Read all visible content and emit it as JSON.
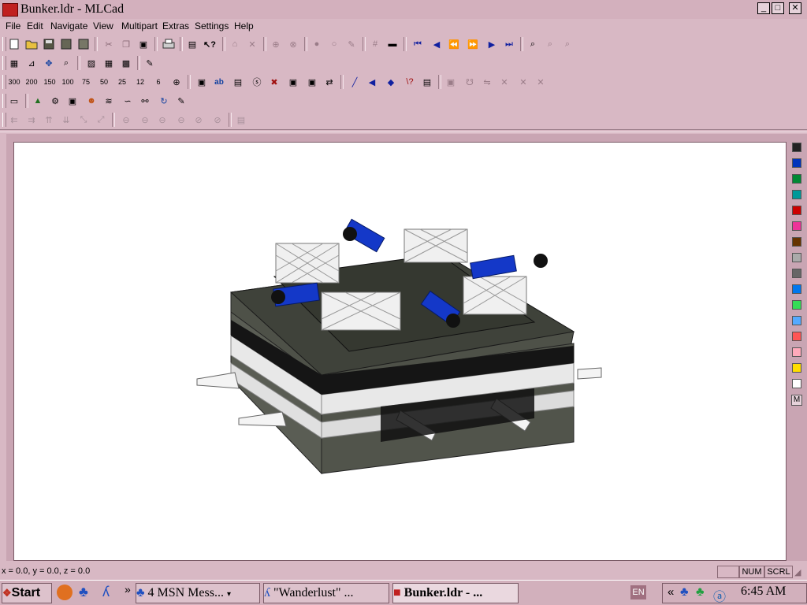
{
  "window": {
    "title": "Bunker.ldr - MLCad"
  },
  "menu": [
    "File",
    "Edit",
    "Navigate",
    "View",
    "Multipart",
    "Extras",
    "Settings",
    "Help"
  ],
  "zoom_toolbar": [
    "300",
    "200",
    "150",
    "100",
    "75",
    "50",
    "25",
    "12",
    "6"
  ],
  "colors": {
    "palette": [
      "#222222",
      "#0033bb",
      "#008833",
      "#009999",
      "#cc0000",
      "#ee3399",
      "#663300",
      "#aaaaaa",
      "#666666",
      "#0077ee",
      "#33dd55",
      "#55aaff",
      "#ff5555",
      "#ffaabb",
      "#ffdd00",
      "#ffffff"
    ]
  },
  "palette_more_label": "M",
  "status": {
    "coords": "x = 0.0, y = 0.0, z = 0.0",
    "num": "NUM",
    "scrl": "SCRL"
  },
  "taskbar": {
    "start": "Start",
    "overflow": "»",
    "items": [
      "4 MSN Mess...",
      "\"Wanderlust\" ...",
      "Bunker.ldr - ..."
    ],
    "lang": "EN",
    "tray_chevron": "«",
    "clock": "6:45 AM"
  }
}
